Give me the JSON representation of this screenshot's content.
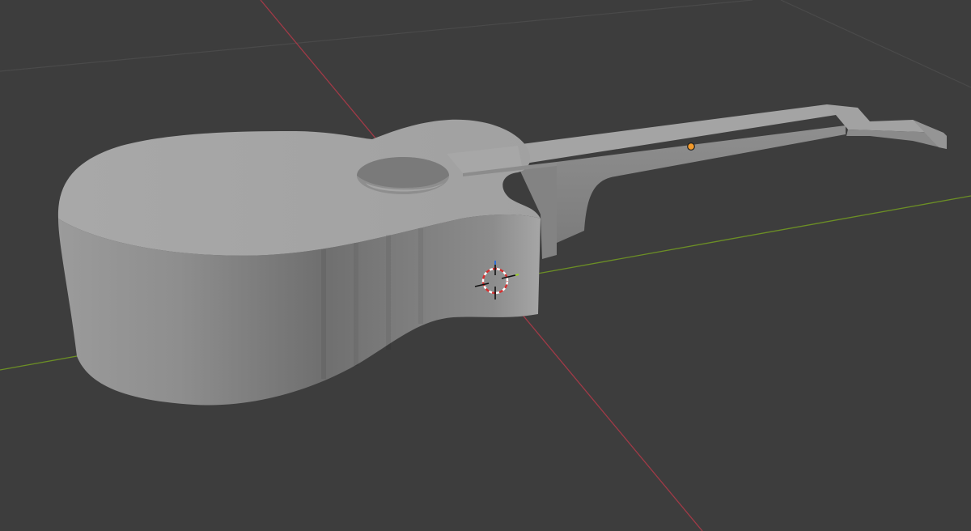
{
  "app": {
    "view": "3D Viewport",
    "object_name": "",
    "shading": "solid"
  },
  "colors": {
    "background": "#3d3d3d",
    "grid_line": "#474747",
    "x_axis": "#a13a47",
    "y_axis": "#6c8f25",
    "mesh_top": "#a3a3a3",
    "mesh_side_light": "#9a9a9a",
    "mesh_side_dark": "#6e6e6e",
    "origin_point": "#f39a2b",
    "cursor_red": "#d62f2f",
    "cursor_white": "#ffffff"
  },
  "scene": {
    "object": "guitar-mesh",
    "selected": false,
    "cursor_visible": true,
    "origin_visible": true
  }
}
